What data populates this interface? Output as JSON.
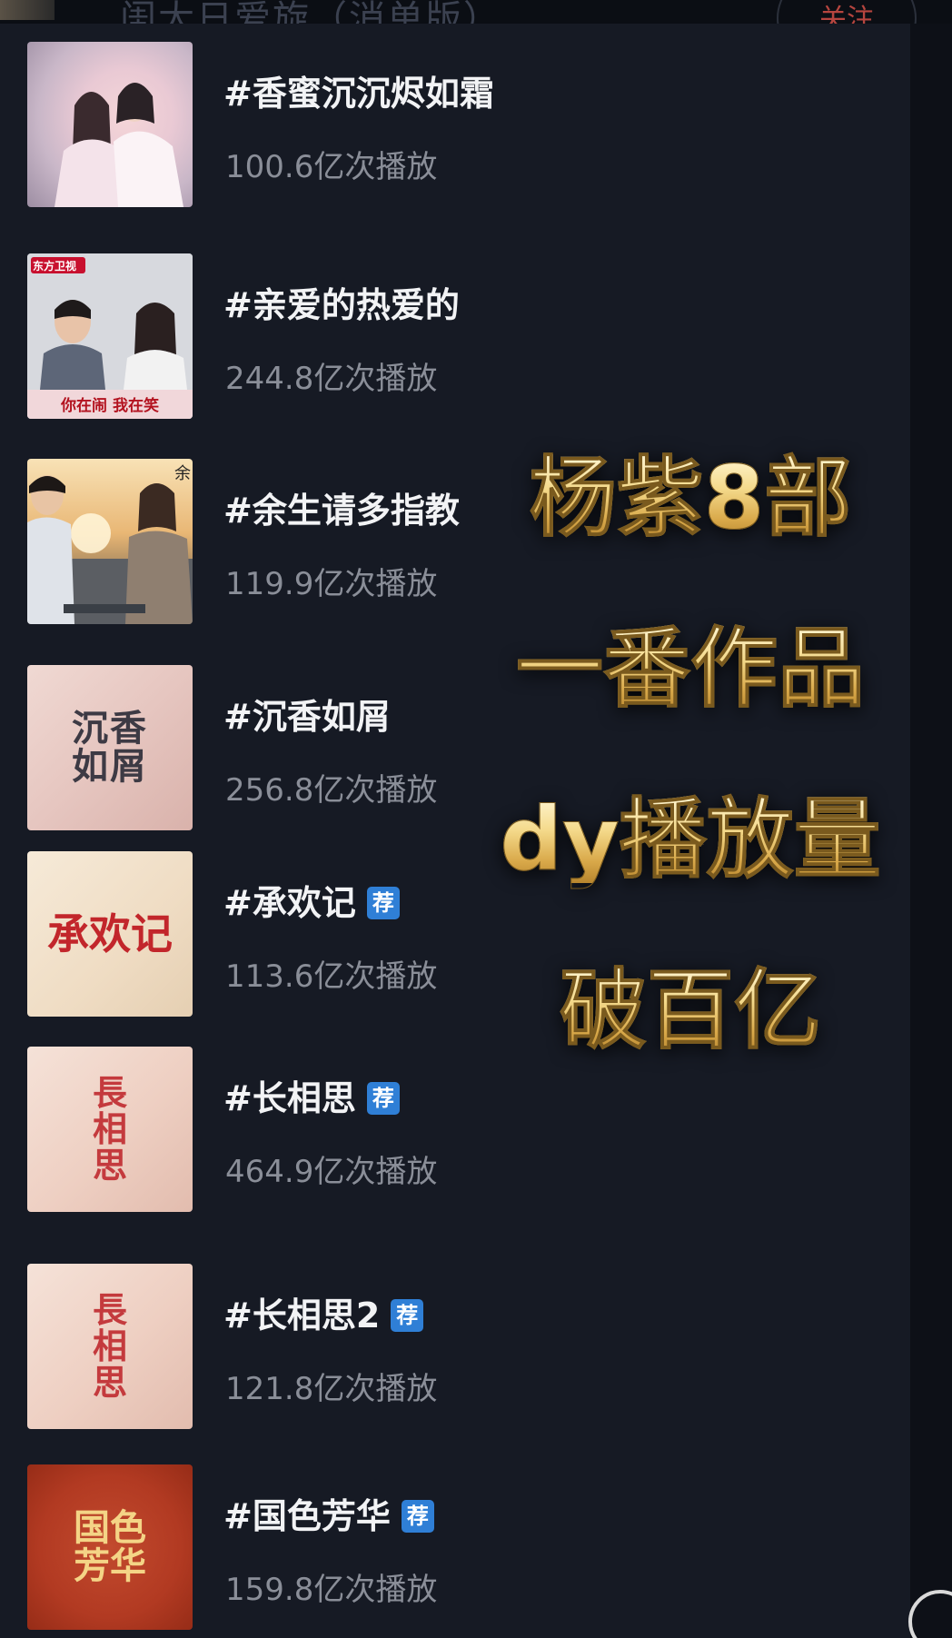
{
  "header": {
    "title": "闺大日爱旋（消单版）",
    "follow_label": "关注"
  },
  "items": [
    {
      "title": "#香蜜沉沉烬如霜",
      "count": "100.6亿次播放",
      "badge": "",
      "thumb_text": ""
    },
    {
      "title": "#亲爱的热爱的",
      "count": "244.8亿次播放",
      "badge": "",
      "thumb_text": "你在闹 我在笑",
      "thumb_logo": "东方卫视"
    },
    {
      "title": "#余生请多指教",
      "count": "119.9亿次播放",
      "badge": "",
      "thumb_text": "余"
    },
    {
      "title": "#沉香如屑",
      "count": "256.8亿次播放",
      "badge": "",
      "thumb_text": "沉香如屑"
    },
    {
      "title": "#承欢记",
      "count": "113.6亿次播放",
      "badge": "荐",
      "thumb_text": "承欢记"
    },
    {
      "title": "#长相思",
      "count": "464.9亿次播放",
      "badge": "荐",
      "thumb_text": "長相思"
    },
    {
      "title": "#长相思2",
      "count": "121.8亿次播放",
      "badge": "荐",
      "thumb_text": "長相思"
    },
    {
      "title": "#国色芳华",
      "count": "159.8亿次播放",
      "badge": "荐",
      "thumb_text": "国色芳华"
    }
  ],
  "overlay": {
    "line1": "杨紫8部",
    "line2": "一番作品",
    "line3": "dy播放量",
    "line4": "破百亿"
  },
  "colors": {
    "background": "#161a24",
    "title_text": "#f2f3f5",
    "count_text": "#8a8e98",
    "badge": "#2f7fd6",
    "overlay_gold": "#e8c56a"
  }
}
